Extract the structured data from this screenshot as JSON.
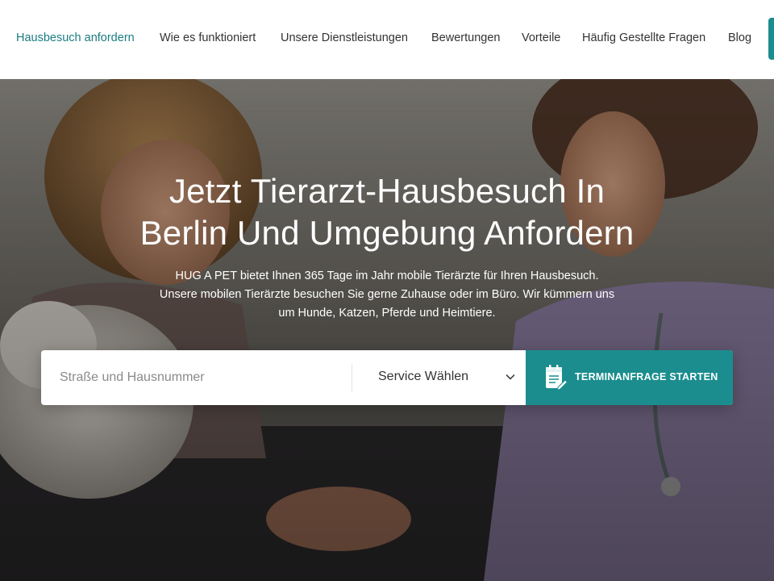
{
  "nav": {
    "items": [
      {
        "label": "Hausbesuch anfordern",
        "active": true
      },
      {
        "label": "Wie es funktioniert"
      },
      {
        "label": "Unsere Dienstleistungen"
      },
      {
        "label": "Bewertungen"
      },
      {
        "label": "Vorteile"
      },
      {
        "label": "Häufig Gestellte Fragen"
      },
      {
        "label": "Blog"
      }
    ]
  },
  "hero": {
    "title_lines": [
      "Jetzt Tierarzt-Hausbesuch In",
      "Berlin Und Umgebung Anfordern"
    ],
    "subtitle_lines": [
      "HUG A PET bietet Ihnen 365 Tage im Jahr mobile Tierärzte für Ihren Hausbesuch.",
      "Unsere mobilen Tierärzte besuchen Sie gerne Zuhause oder im Büro. Wir kümmern uns",
      "um Hunde, Katzen, Pferde und Heimtiere."
    ]
  },
  "search": {
    "address_placeholder": "Straße und Hausnummer",
    "address_value": "",
    "service_selected": "Service Wählen",
    "submit_label": "TERMINANFRAGE STARTEN"
  },
  "icons": {
    "dropdown": "chevron-down-icon",
    "submit": "calendar-edit-icon"
  },
  "colors": {
    "accent": "#1b8d8e",
    "nav_active": "#1b7c81",
    "nav_text": "#333333"
  }
}
